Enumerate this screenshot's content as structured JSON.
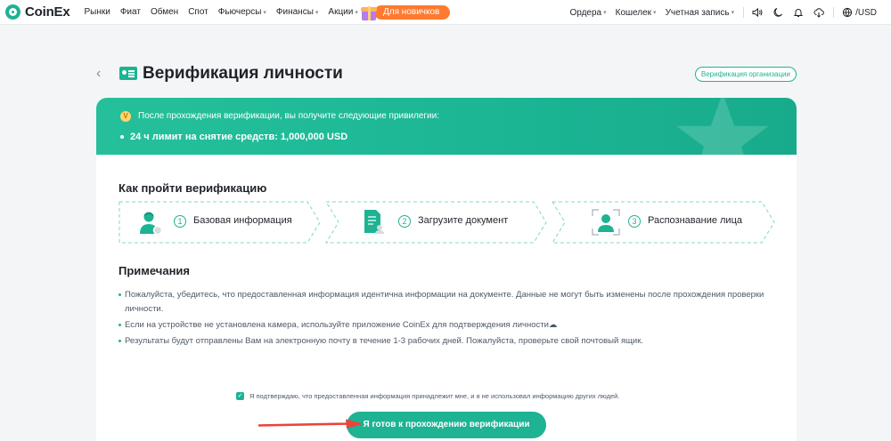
{
  "brand": {
    "name": "CoinEx",
    "accent": "#1db393",
    "promo_color": "#ff7a2f"
  },
  "nav": {
    "items": [
      {
        "label": "Рынки",
        "has_dropdown": false
      },
      {
        "label": "Фиат",
        "has_dropdown": false
      },
      {
        "label": "Обмен",
        "has_dropdown": false
      },
      {
        "label": "Спот",
        "has_dropdown": false
      },
      {
        "label": "Фьючерсы",
        "has_dropdown": true
      },
      {
        "label": "Финансы",
        "has_dropdown": true
      },
      {
        "label": "Акции",
        "has_dropdown": true
      }
    ],
    "promo_label": "Для новичков",
    "right": {
      "orders": "Ордера",
      "wallet": "Кошелек",
      "account": "Учетная запись",
      "currency": "/USD",
      "icons": [
        "volume-icon",
        "moon-icon",
        "bell-icon",
        "download-icon",
        "globe-icon"
      ]
    }
  },
  "page": {
    "title": "Верификация личности",
    "org_button": "Верификация организации"
  },
  "banner": {
    "badge": "V",
    "intro": "После прохождения верификации, вы получите следующие привилегии:",
    "privilege": "24 ч лимит на снятие средств: 1,000,000 USD"
  },
  "steps_section": {
    "title": "Как пройти верификацию",
    "steps": [
      {
        "num": "1",
        "label": "Базовая информация",
        "icon": "user-icon"
      },
      {
        "num": "2",
        "label": "Загрузите документ",
        "icon": "document-icon"
      },
      {
        "num": "3",
        "label": "Распознавание лица",
        "icon": "face-scan-icon"
      }
    ]
  },
  "notes": {
    "title": "Примечания",
    "items": [
      "Пожалуйста, убедитесь, что предоставленная информация идентична информации на документе. Данные не могут быть изменены после прохождения проверки личности.",
      "Если на устройстве не установлена камера, используйте приложение CoinEx для подтверждения личности",
      "Результаты будут отправлены Вам на электронную почту в течение 1-3 рабочих дней. Пожалуйста, проверьте свой почтовый ящик."
    ]
  },
  "agreement": {
    "checked": true,
    "text": "Я подтверждаю, что предоставленная информация принадлежит мне, и я не использовал информацию других людей."
  },
  "submit_button": "Я готов к прохождению верификации"
}
